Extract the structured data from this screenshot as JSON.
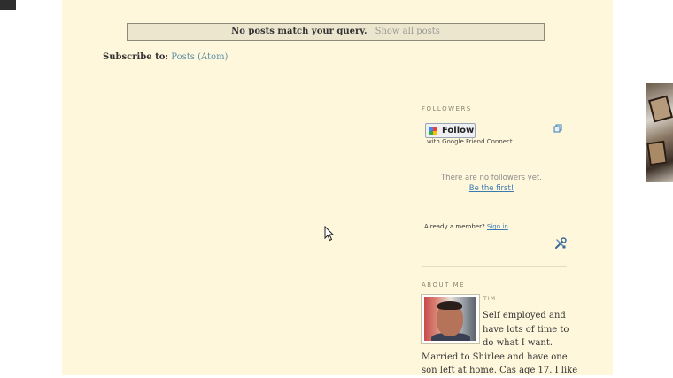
{
  "message_bar": {
    "text": "No posts match your query.",
    "link": "Show all posts"
  },
  "subscribe": {
    "label": "Subscribe to:",
    "link": "Posts (Atom)"
  },
  "followers": {
    "heading": "FOLLOWERS",
    "follow_button": "Follow",
    "gfc_text": "with Google Friend Connect",
    "empty_text": "There are no followers yet.",
    "be_first": "Be the first!",
    "member_prompt": "Already a member?",
    "sign_in": "Sign in",
    "icons": [
      "copy-icon",
      "tools-icon"
    ]
  },
  "about": {
    "heading": "ABOUT ME",
    "name": "TIM",
    "bio_lines_wrap": [
      "Self employed and",
      "have lots of time to",
      "do what I want."
    ],
    "bio_lines_full": [
      "Married to Shirlee and have one",
      "son left at home. Cas age 17. I like"
    ]
  },
  "colors": {
    "page_bg": "#fff7dc",
    "link": "#5b8fa8",
    "gfc_link": "#3a7ab0"
  }
}
